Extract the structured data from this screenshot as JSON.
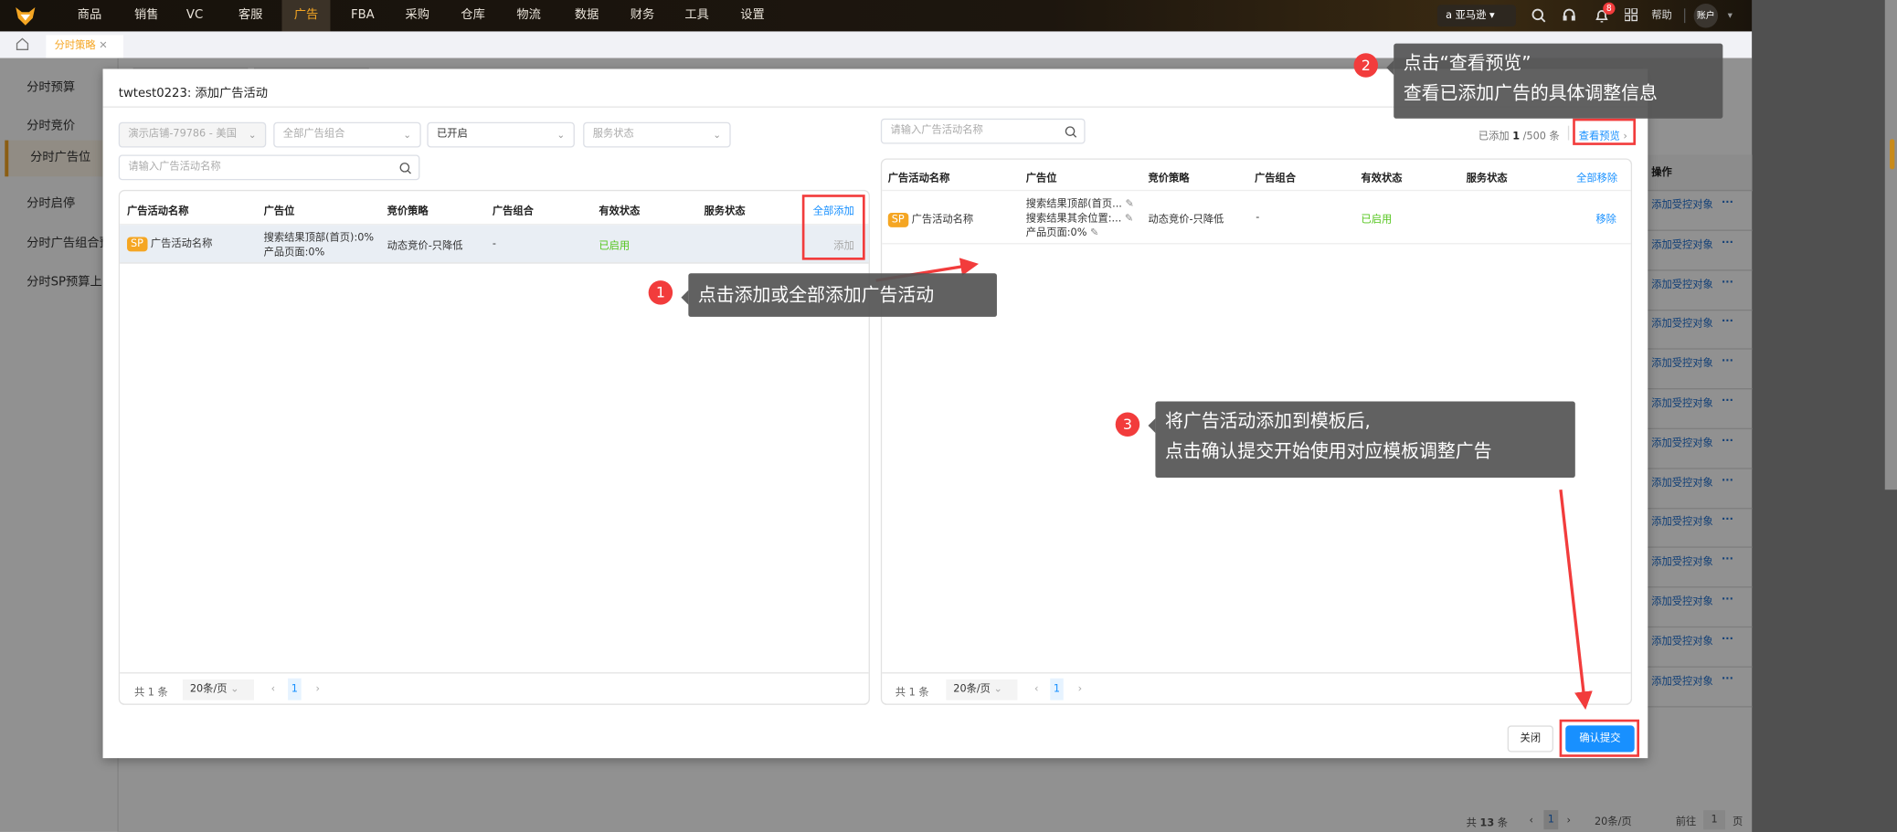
{
  "nav": {
    "items": [
      "商品",
      "销售",
      "VC",
      "客服",
      "广告",
      "FBA",
      "采购",
      "仓库",
      "物流",
      "数据",
      "财务",
      "工具",
      "设置"
    ],
    "active_index": 4,
    "marketplace": "亚马逊",
    "notification_count": "8",
    "help": "帮助",
    "account": "账户"
  },
  "tabs": {
    "active_tab": "分时策略"
  },
  "sidebar": {
    "items": [
      "分时预算",
      "分时竞价",
      "分时广告位",
      "分时启停",
      "分时广告组合预",
      "分时SP预算上限"
    ],
    "active_index": 2
  },
  "bg_table": {
    "header_action": "操作",
    "row_action": "添加受控对象",
    "row_more": "···",
    "row_count": 13,
    "pagination": {
      "total_prefix": "共",
      "total": "13",
      "total_suffix": "条",
      "page": "1",
      "page_size": "20条/页",
      "goto": "前往",
      "goto_page": "1",
      "page_suffix": "页"
    }
  },
  "dialog": {
    "title": "twtest0223: 添加广告活动",
    "left": {
      "filters": {
        "store": "演示店铺-79786 - 美国",
        "portfolio": "全部广告组合",
        "state": "已开启",
        "service_status": "服务状态",
        "search_placeholder": "请输入广告活动名称"
      },
      "columns": [
        "广告活动名称",
        "广告位",
        "竞价策略",
        "广告组合",
        "有效状态",
        "服务状态"
      ],
      "add_all": "全部添加",
      "rows": [
        {
          "badge": "SP",
          "name": "广告活动名称",
          "placement": [
            "搜索结果顶部(首页):0%",
            "产品页面:0%"
          ],
          "bidding": "动态竞价-只降低",
          "portfolio": "-",
          "status": "已启用",
          "action": "添加"
        }
      ],
      "pagination": {
        "total": "共 1 条",
        "page_size": "20条/页",
        "page": "1"
      }
    },
    "right": {
      "search_placeholder": "请输入广告活动名称",
      "added_prefix": "已添加",
      "added_count": "1",
      "added_suffix": "/500 条",
      "preview": "查看预览",
      "columns": [
        "广告活动名称",
        "广告位",
        "竞价策略",
        "广告组合",
        "有效状态",
        "服务状态"
      ],
      "remove_all": "全部移除",
      "rows": [
        {
          "badge": "SP",
          "name": "广告活动名称",
          "placement": [
            "搜索结果顶部(首页...",
            "搜索结果其余位置:...",
            "产品页面:0%"
          ],
          "bidding": "动态竞价-只降低",
          "portfolio": "-",
          "status": "已启用",
          "action": "移除"
        }
      ],
      "pagination": {
        "total": "共 1 条",
        "page_size": "20条/页",
        "page": "1"
      }
    },
    "close": "关闭",
    "submit": "确认提交"
  },
  "callouts": [
    {
      "num": "1",
      "lines": [
        "点击添加或全部添加广告活动"
      ]
    },
    {
      "num": "2",
      "lines": [
        "点击“查看预览”",
        "查看已添加广告的具体调整信息"
      ]
    },
    {
      "num": "3",
      "lines": [
        "将广告活动添加到模板后,",
        "点击确认提交开始使用对应模板调整广告"
      ]
    }
  ],
  "colors": {
    "accent": "#f5a623",
    "primary": "#1890ff",
    "success": "#52c41a",
    "annotation": "#f23c3c"
  }
}
